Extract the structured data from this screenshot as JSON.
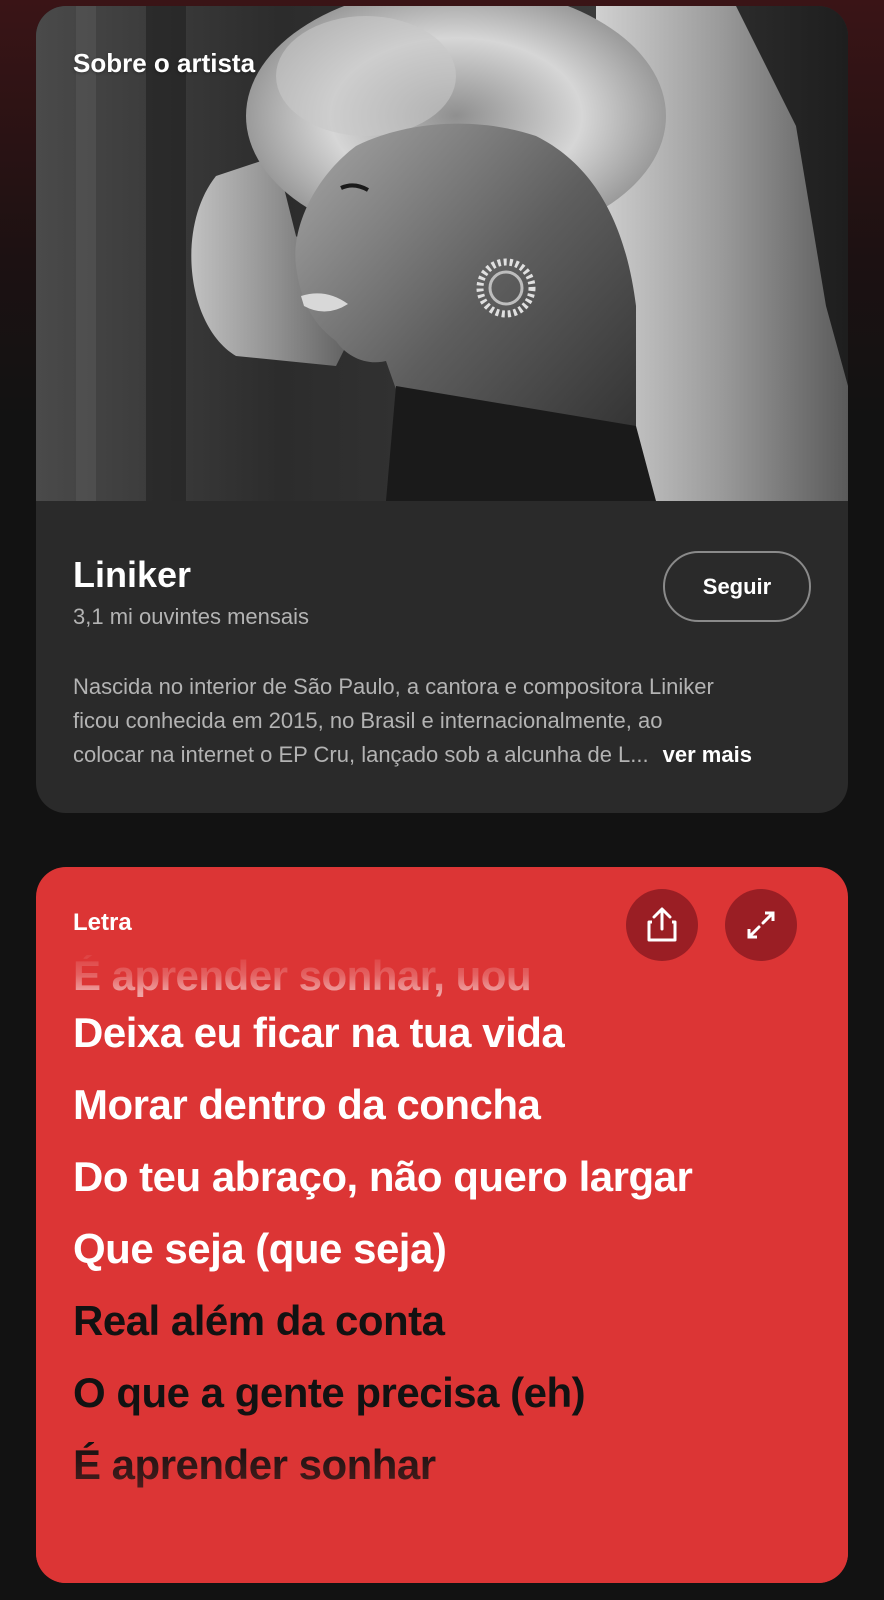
{
  "artist_card": {
    "section_label": "Sobre o artista",
    "name": "Liniker",
    "listeners": "3,1 mi ouvintes mensais",
    "follow_label": "Seguir",
    "bio_lines": [
      "Nascida no interior de São Paulo, a cantora e compositora Liniker",
      "ficou conhecida em 2015, no Brasil e internacionalmente, ao",
      "colocar na internet o EP Cru, lançado sob a alcunha de L..."
    ],
    "see_more_label": "ver mais"
  },
  "lyrics_card": {
    "section_label": "Letra",
    "share_icon": "share-icon",
    "expand_icon": "expand-icon",
    "faded_line": "É aprender sonhar, uou",
    "lines": [
      {
        "text": "Deixa eu ficar na tua vida",
        "state": "past"
      },
      {
        "text": "Morar dentro da concha",
        "state": "past"
      },
      {
        "text": "Do teu abraço, não quero largar",
        "state": "past"
      },
      {
        "text": "Que seja (que seja)",
        "state": "past"
      },
      {
        "text": "Real além da conta",
        "state": "future"
      },
      {
        "text": "O que a gente precisa (eh)",
        "state": "future"
      },
      {
        "text": "É aprender sonhar",
        "state": "future"
      }
    ]
  },
  "colors": {
    "background": "#121212",
    "card": "#2a2a2a",
    "lyrics_bg": "#dc3535",
    "lyrics_button": "#9a1e24",
    "muted_text": "#b3b3b3"
  }
}
